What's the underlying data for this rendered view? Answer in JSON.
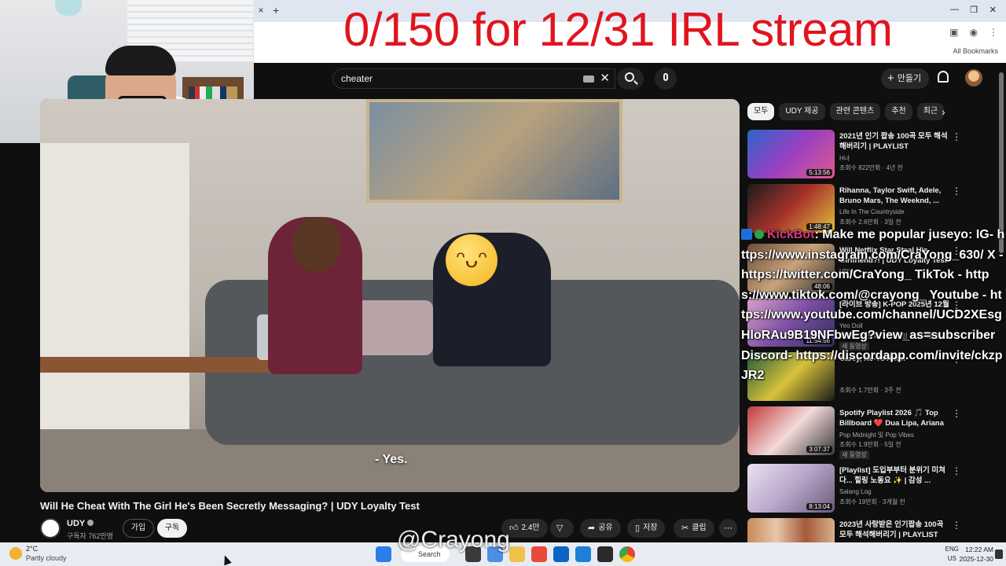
{
  "overlay": {
    "title": "0/150 for 12/31 IRL stream",
    "watermark": "@Crayong"
  },
  "browser": {
    "tab_close": "×",
    "tab_new": "+",
    "all_bookmarks": "All Bookmarks"
  },
  "search": {
    "query": "cheater",
    "clear": "✕"
  },
  "header": {
    "create_label": "만들기"
  },
  "video": {
    "caption": "- Yes.",
    "title": "Will He Cheat With The Girl He's Been Secretly Messaging? | UDY Loyalty Test",
    "channel": "UDY",
    "subscribers": "구독자 762만명",
    "join_label": "가입",
    "subscribe_label": "구독",
    "likes": "2.4만",
    "share_label": "공유",
    "save_label": "저장",
    "clip_label": "클립"
  },
  "chips": [
    "모두",
    "UDY 제공",
    "관련 콘텐츠",
    "추천",
    "최근"
  ],
  "recommendations": [
    {
      "title": "2021년 인기 팝송 100곡 모두 해석해버리기 | PLAYLIST",
      "channel": "H녀",
      "meta": "조회수 822만회 · 4년 전",
      "duration": "5:13:56",
      "badge": ""
    },
    {
      "title": "Rihanna, Taylor Swift, Adele, Bruno Mars, The Weeknd, ...",
      "channel": "Life In The Countryside",
      "meta": "조회수 2.6만회 · 3일 전",
      "duration": "1:48:47",
      "badge": ""
    },
    {
      "title": "Will Netflix Star Steal His Girlfriend?! | UDY Loyalty Test",
      "channel": "UDY",
      "meta": "",
      "duration": "48:06",
      "badge": ""
    },
    {
      "title": "[라이브 방송] K-POP 2025년 12월",
      "channel": "Yeo Doll",
      "meta": "조회수 3.9천회 · 스트리밍 시간: 4일 전",
      "duration": "11:54:56",
      "badge": "새 동영상"
    },
    {
      "title": "Carey, Ne-Yo Akon",
      "channel": "",
      "meta": "조회수 1.7만회 · 3주 전",
      "duration": "",
      "badge": ""
    },
    {
      "title": "Spotify Playlist 2026 🎵 Top Billboard ❤️ Dua Lipa, Ariana ...",
      "channel": "Pop Midnight 및 Pop Vibes",
      "meta": "조회수 1.9만회 · 5일 전",
      "duration": "3:07:37",
      "badge": "새 동영상"
    },
    {
      "title": "[Playlist] 도입부부터 분위기 미쳐다... 힐링 노동요 ✨ | 감성 ...",
      "channel": "Salang Log",
      "meta": "조회수 19만회 · 3개월 전",
      "duration": "8:13:04",
      "badge": ""
    },
    {
      "title": "2023년 사랑받은 인기팝송 100곡 모두 해석해버리기 | PLAYLIST",
      "channel": "",
      "meta": "",
      "duration": "",
      "badge": ""
    }
  ],
  "chat": {
    "bot_name": "KickBot",
    "message": ": Make me popular juseyo: IG- https://www.instagram.com/CraYong_630/ X - https://twitter.com/CraYong_ TikTok - https://www.tiktok.com/@crayong_ Youtube - https://www.youtube.com/channel/UCD2XEsgHloRAu9B19NFbwEg?view_as=subscriber Discord- https://discordapp.com/invite/ckzpJR2"
  },
  "taskbar": {
    "temperature": "2°C",
    "condition": "Partly cloudy",
    "search_label": "Search",
    "lang_top": "ENG",
    "lang_bottom": "US",
    "time": "12:22 AM",
    "date": "2025-12-30"
  },
  "colors": {
    "overlay_red": "#e1141e",
    "yt_bg": "#0f0f0f",
    "bot_name": "#d63a7a"
  }
}
